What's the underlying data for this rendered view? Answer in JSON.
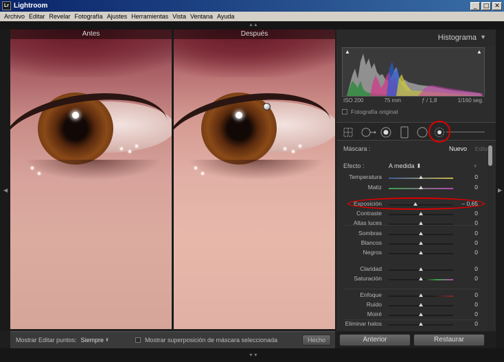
{
  "window": {
    "title": "Lightroom",
    "icon_text": "Lr",
    "minimize": "_",
    "maximize": "□",
    "close": "✕"
  },
  "menu": [
    "Archivo",
    "Editar",
    "Revelar",
    "Fotografía",
    "Ajustes",
    "Herramientas",
    "Vista",
    "Ventana",
    "Ayuda"
  ],
  "compare": {
    "before_label": "Antes",
    "after_label": "Después"
  },
  "toolbar": {
    "show_points_label": "Mostrar Editar puntos:",
    "show_points_value": "Siempre",
    "overlay_label": "Mostrar superposición de máscara seleccionada",
    "done_label": "Hecho"
  },
  "histogram": {
    "title": "Histograma",
    "iso": "ISO 200",
    "focal": "75 mm",
    "aperture": "ƒ / 1,8",
    "shutter": "1/160 seg.",
    "original_label": "Fotografía original"
  },
  "mask": {
    "label": "Máscara :",
    "new": "Nuevo",
    "edit": "Editar"
  },
  "effect": {
    "label": "Efecto :",
    "value": "A medida"
  },
  "sliders": [
    {
      "label": "Temperatura",
      "value": "0",
      "pos": 0.5,
      "gradient": "linear-gradient(to right, #3d5c9c, #c9b54a)"
    },
    {
      "label": "Matiz",
      "value": "0",
      "pos": 0.5,
      "gradient": "linear-gradient(to right, #3aa34a, #b54ab5)"
    },
    {
      "label": "Exposición",
      "value": "– 0,65",
      "pos": 0.42,
      "gradient": ""
    },
    {
      "label": "Contraste",
      "value": "0",
      "pos": 0.5,
      "gradient": ""
    },
    {
      "label": "Altas luces",
      "value": "0",
      "pos": 0.5,
      "gradient": ""
    },
    {
      "label": "Sombras",
      "value": "0",
      "pos": 0.5,
      "gradient": ""
    },
    {
      "label": "Blancos",
      "value": "0",
      "pos": 0.5,
      "gradient": ""
    },
    {
      "label": "Negros",
      "value": "0",
      "pos": 0.5,
      "gradient": ""
    },
    {
      "label": "Claridad",
      "value": "0",
      "pos": 0.5,
      "gradient": ""
    },
    {
      "label": "Saturación",
      "value": "0",
      "pos": 0.5,
      "gradient": "linear-gradient(to right, #1d1d1d 55%, #3aa34a 75%, #b54ab5)"
    },
    {
      "label": "Enfoque",
      "value": "0",
      "pos": 0.5,
      "gradient": "linear-gradient(to right, #1d1d1d 70%, #8a2a2a)"
    },
    {
      "label": "Ruido",
      "value": "0",
      "pos": 0.5,
      "gradient": ""
    },
    {
      "label": "Moiré",
      "value": "0",
      "pos": 0.5,
      "gradient": ""
    },
    {
      "label": "Eliminar halos",
      "value": "0",
      "pos": 0.5,
      "gradient": ""
    }
  ],
  "buttons": {
    "previous": "Anterior",
    "reset": "Restaurar"
  },
  "colors": {
    "highlight_red": "#dd0000",
    "panel_bg": "#2c2c2c"
  }
}
